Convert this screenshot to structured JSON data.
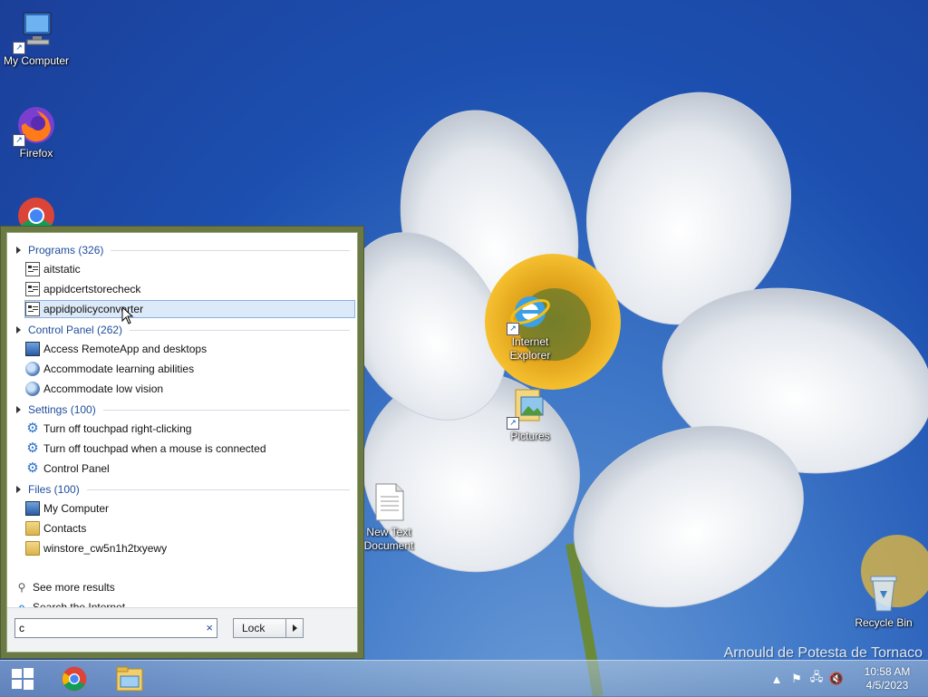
{
  "desktop": {
    "icons": {
      "my_computer": "My Computer",
      "firefox": "Firefox",
      "ie_line1": "Internet",
      "ie_line2": "Explorer",
      "pictures": "Pictures",
      "new_text_line1": "New Text",
      "new_text_line2": "Document",
      "recycle_bin": "Recycle Bin"
    },
    "watermark": "Arnould de Potesta de Tornaco"
  },
  "start_menu": {
    "groups": {
      "programs": "Programs (326)",
      "control_panel": "Control Panel (262)",
      "settings": "Settings (100)",
      "files": "Files (100)"
    },
    "programs": [
      "aitstatic",
      "appidcertstorecheck",
      "appidpolicyconverter"
    ],
    "control_panel": [
      "Access RemoteApp and desktops",
      "Accommodate learning abilities",
      "Accommodate low vision"
    ],
    "settings": [
      "Turn off touchpad right-clicking",
      "Turn off touchpad when a mouse is connected",
      "Control Panel"
    ],
    "files": [
      "My Computer",
      "Contacts",
      "winstore_cw5n1h2txyewy"
    ],
    "see_more": "See more results",
    "search_internet": "Search the Internet",
    "search_value": "c",
    "clear_glyph": "×",
    "lock_label": "Lock"
  },
  "taskbar": {
    "time": "10:58 AM",
    "date": "4/5/2023"
  },
  "colors": {
    "panel_border": "#6b7a45",
    "group_text": "#1e4d9b",
    "selection": "#dce9f8"
  }
}
